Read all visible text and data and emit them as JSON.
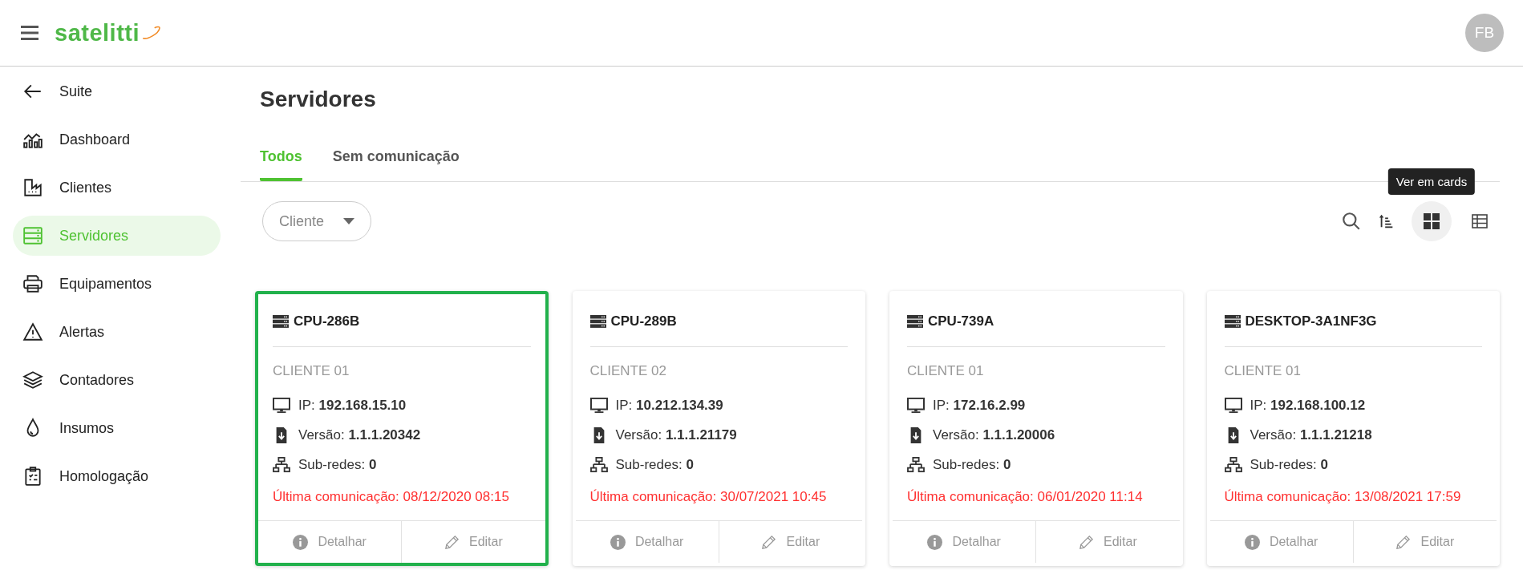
{
  "header": {
    "logo": "satelitti",
    "avatar": "FB"
  },
  "sidebar": {
    "items": [
      {
        "kind": "back",
        "label": "Suite",
        "selected": false
      },
      {
        "kind": "dashboard",
        "label": "Dashboard",
        "selected": false
      },
      {
        "kind": "clients",
        "label": "Clientes",
        "selected": false
      },
      {
        "kind": "servers",
        "label": "Servidores",
        "selected": true
      },
      {
        "kind": "printer",
        "label": "Equipamentos",
        "selected": false
      },
      {
        "kind": "alert",
        "label": "Alertas",
        "selected": false
      },
      {
        "kind": "layers",
        "label": "Contadores",
        "selected": false
      },
      {
        "kind": "drop",
        "label": "Insumos",
        "selected": false
      },
      {
        "kind": "clipboard",
        "label": "Homologação",
        "selected": false
      }
    ]
  },
  "page": {
    "title": "Servidores",
    "tabs": [
      {
        "label": "Todos",
        "selected": true
      },
      {
        "label": "Sem comunicação",
        "selected": false
      }
    ],
    "filter": {
      "label": "Cliente"
    },
    "tooltip": "Ver em cards",
    "views": [
      {
        "kind": "cards",
        "selected": true
      },
      {
        "kind": "table",
        "selected": false
      }
    ]
  },
  "cards": [
    {
      "name": "CPU-286B",
      "selected": true,
      "client": "CLIENTE 01",
      "rows": [
        {
          "kind": "ip",
          "text": "IP: **192.168.15.10**"
        },
        {
          "kind": "version",
          "text": "Versão: **1.1.1.20342**"
        },
        {
          "kind": "subnets",
          "text": "Sub-redes: **0**"
        }
      ],
      "last_communication": "Última comunicação: 08/12/2020 08:15",
      "actions": [
        "Detalhar",
        "Editar"
      ]
    },
    {
      "name": "CPU-289B",
      "selected": false,
      "client": "CLIENTE 02",
      "rows": [
        {
          "kind": "ip",
          "text": "IP: **10.212.134.39**"
        },
        {
          "kind": "version",
          "text": "Versão: **1.1.1.21179**"
        },
        {
          "kind": "subnets",
          "text": "Sub-redes: **0**"
        }
      ],
      "last_communication": "Última comunicação: 30/07/2021 10:45",
      "actions": [
        "Detalhar",
        "Editar"
      ]
    },
    {
      "name": "CPU-739A",
      "selected": false,
      "client": "CLIENTE 01",
      "rows": [
        {
          "kind": "ip",
          "text": "IP: **172.16.2.99**"
        },
        {
          "kind": "version",
          "text": "Versão: **1.1.1.20006**"
        },
        {
          "kind": "subnets",
          "text": "Sub-redes: **0**"
        }
      ],
      "last_communication": "Última comunicação: 06/01/2020 11:14",
      "actions": [
        "Detalhar",
        "Editar"
      ]
    },
    {
      "name": "DESKTOP-3A1NF3G",
      "selected": false,
      "client": "CLIENTE 01",
      "rows": [
        {
          "kind": "ip",
          "text": "IP: **192.168.100.12**"
        },
        {
          "kind": "version",
          "text": "Versão: **1.1.1.21218**"
        },
        {
          "kind": "subnets",
          "text": "Sub-redes: **0**"
        }
      ],
      "last_communication": "Última comunicação: 13/08/2021 17:59",
      "actions": [
        "Detalhar",
        "Editar"
      ]
    }
  ]
}
